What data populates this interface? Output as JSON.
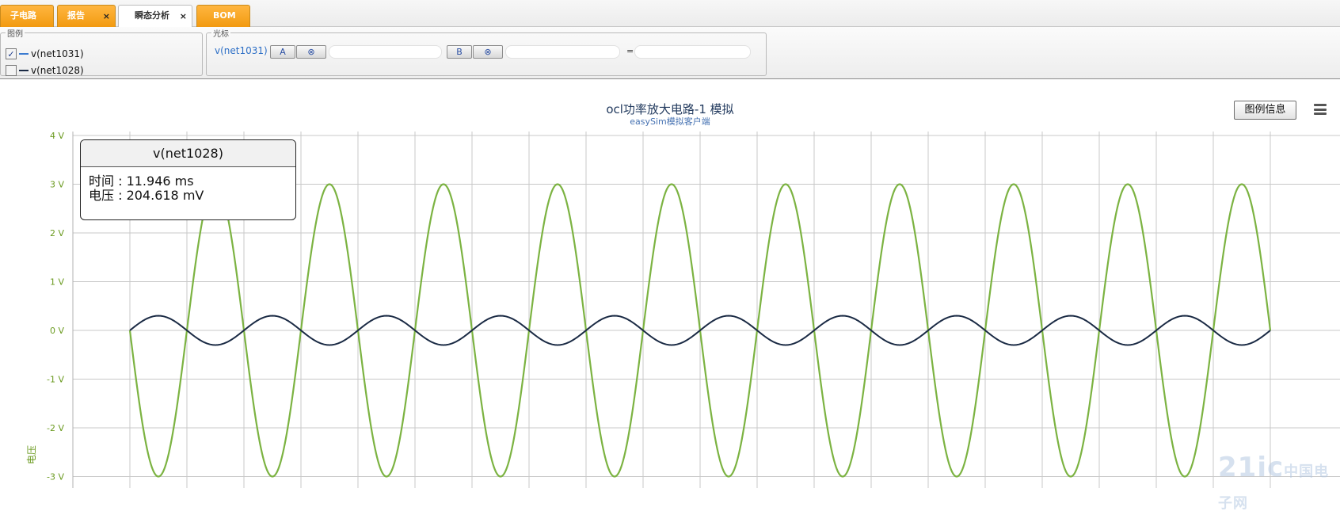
{
  "tabs": [
    {
      "label": "子电路",
      "active": false,
      "closable": false
    },
    {
      "label": "报告",
      "active": false,
      "closable": true
    },
    {
      "label": "瞬态分析",
      "active": true,
      "closable": true
    },
    {
      "label": "BOM",
      "active": false,
      "closable": false
    }
  ],
  "close_glyph": "×",
  "legend_panel": {
    "title": "图例",
    "items": [
      {
        "label": "v(net1031)",
        "checked": true,
        "color": "#3b7bd0"
      },
      {
        "label": "v(net1028)",
        "checked": false,
        "color": "#1a2a44"
      }
    ]
  },
  "cursor_panel": {
    "title": "光标",
    "signal": "v(net1031)",
    "button_a": "A",
    "button_b": "B",
    "clear_glyph": "⊗",
    "equals": "=",
    "value_a": "",
    "value_b": "",
    "value_diff": ""
  },
  "chart_header": {
    "title": "ocl功率放大电路-1 模拟",
    "subtitle": "easySim模拟客户端",
    "legend_button": "图例信息",
    "menu_icon": "hamburger-icon"
  },
  "tooltip": {
    "series": "v(net1028)",
    "line1": "时间 : 11.946 ms",
    "line2": "电压 : 204.618 mV"
  },
  "watermark": {
    "main": "21ic",
    "sub": "中国电子网"
  },
  "chart_data": {
    "type": "line",
    "title": "ocl功率放大电路-1 模拟",
    "subtitle": "easySim模拟客户端",
    "ylabel": "电压",
    "ylim": [
      -3.1,
      4
    ],
    "y_ticks": [
      4,
      3,
      2,
      1,
      0,
      -1,
      -2,
      -3
    ],
    "y_tick_labels": [
      "4 V",
      "3 V",
      "2 V",
      "1 V",
      "0 V",
      "-1 V",
      "-2 V",
      "-3 V"
    ],
    "x_periods": 10,
    "grid": true,
    "series": [
      {
        "name": "v(net1031)",
        "color": "#7cb342",
        "amplitude": 3.0,
        "phase": "cosine, negative start",
        "periods": 10
      },
      {
        "name": "v(net1028)",
        "color": "#1a2a44",
        "amplitude": 0.3,
        "phase": "sine",
        "periods": 10
      }
    ],
    "colors": {
      "axis_label": "#6a9a1f",
      "grid": "#c8c8c8"
    }
  }
}
